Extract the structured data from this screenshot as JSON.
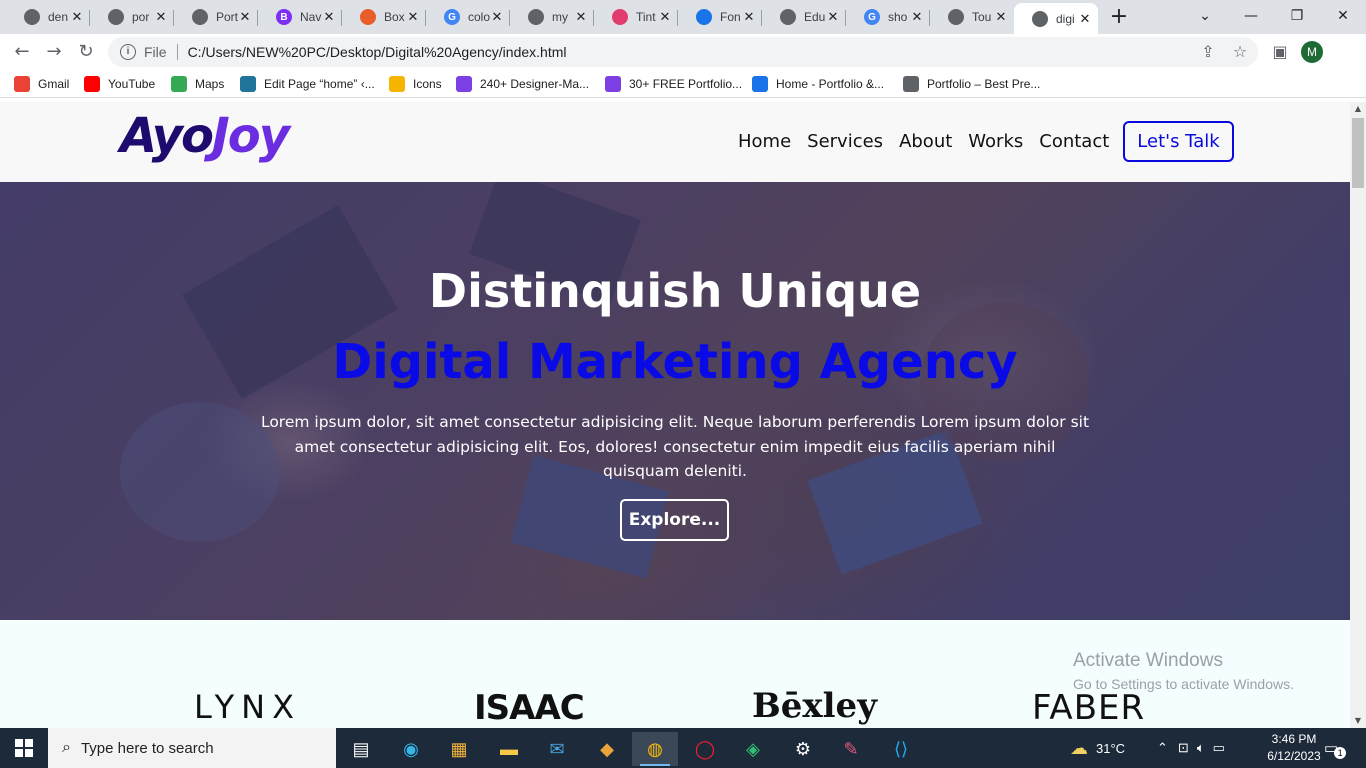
{
  "browser": {
    "tabs": [
      {
        "title": "den",
        "color": "#5f6368"
      },
      {
        "title": "por",
        "color": "#5f6368"
      },
      {
        "title": "Port",
        "color": "#5f6368"
      },
      {
        "title": "Nav",
        "color": "#7b2ff7",
        "badge": "B"
      },
      {
        "title": "Box",
        "color": "#e85d2a"
      },
      {
        "title": "colo",
        "color": "#4285f4",
        "badge": "G"
      },
      {
        "title": "my",
        "color": "#5f6368"
      },
      {
        "title": "Tint",
        "color": "#e23b6d"
      },
      {
        "title": "Fon",
        "color": "#1a73e8"
      },
      {
        "title": "Edu",
        "color": "#5f6368"
      },
      {
        "title": "sho",
        "color": "#4285f4",
        "badge": "G"
      },
      {
        "title": "Tou",
        "color": "#5f6368"
      },
      {
        "title": "digi",
        "color": "#5f6368"
      }
    ],
    "new_tab": "+",
    "url_scheme": "File",
    "url": "C:/Users/NEW%20PC/Desktop/Digital%20Agency/index.html",
    "profile_initial": "M",
    "bookmarks": [
      {
        "label": "Gmail",
        "icon": "gmail-icon",
        "color": "#ea4335"
      },
      {
        "label": "YouTube",
        "icon": "youtube-icon",
        "color": "#ff0000"
      },
      {
        "label": "Maps",
        "icon": "maps-icon",
        "color": "#34a853"
      },
      {
        "label": "Edit Page “home” ‹...",
        "icon": "wordpress-icon",
        "color": "#21759b"
      },
      {
        "label": "Icons",
        "icon": "icons-icon",
        "color": "#f4b400"
      },
      {
        "label": "240+ Designer-Ma...",
        "icon": "a-icon",
        "color": "#7b3fe4"
      },
      {
        "label": "30+ FREE Portfolio...",
        "icon": "a-icon",
        "color": "#7b3fe4"
      },
      {
        "label": "Home - Portfolio &...",
        "icon": "aj-icon",
        "color": "#1a73e8"
      },
      {
        "label": "Portfolio – Best Pre...",
        "icon": "globe-icon",
        "color": "#5f6368"
      }
    ]
  },
  "site": {
    "logo_part1": "Ayo",
    "logo_part2": "Joy",
    "nav": [
      "Home",
      "Services",
      "About",
      "Works",
      "Contact"
    ],
    "cta": "Let's Talk",
    "hero_title": "Distinquish Unique",
    "hero_subtitle": "Digital Marketing Agency",
    "hero_text": "Lorem ipsum dolor, sit amet consectetur adipisicing elit. Neque laborum perferendis Lorem ipsum dolor sit amet consectetur adipisicing elit. Eos, dolores! consectetur enim impedit eius facilis aperiam nihil quisquam deleniti.",
    "hero_button": "Explore...",
    "brands": [
      "LYNX",
      "ISAAC",
      "Bēxley",
      "FABER"
    ],
    "watermark_title": "Activate Windows",
    "watermark_text": "Go to Settings to activate Windows."
  },
  "taskbar": {
    "search_placeholder": "Type here to search",
    "weather": "31°C",
    "time": "3:46 PM",
    "date": "6/12/2023",
    "notification_count": "1"
  }
}
